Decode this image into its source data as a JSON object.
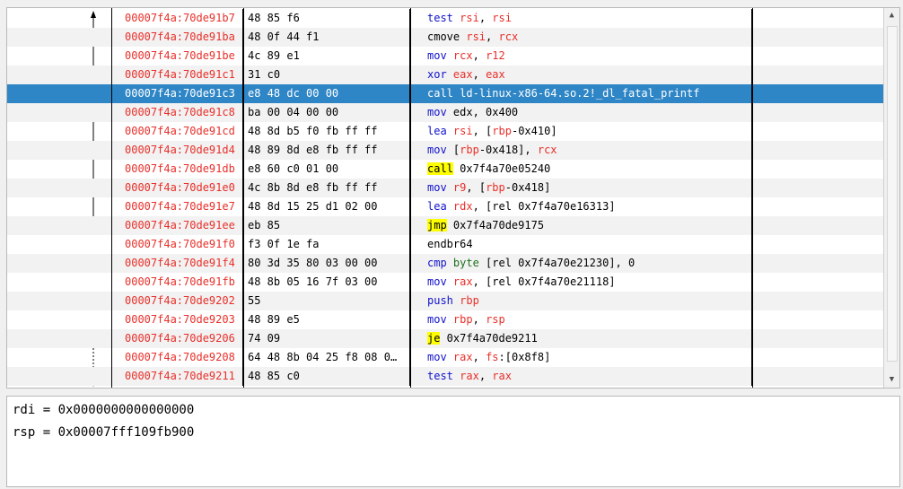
{
  "disassembly": {
    "rows": [
      {
        "addr": "00007f4a:70de91b7",
        "bytes": "48 85 f6",
        "ins": [
          [
            "test",
            "mn-blue"
          ],
          [
            " ",
            ""
          ],
          [
            "rsi",
            "reg"
          ],
          [
            ", ",
            ""
          ],
          [
            "rsi",
            "reg"
          ]
        ]
      },
      {
        "addr": "00007f4a:70de91ba",
        "bytes": "48 0f 44 f1",
        "ins": [
          [
            "cmove",
            "mn-black"
          ],
          [
            " ",
            ""
          ],
          [
            "rsi",
            "reg"
          ],
          [
            ", ",
            ""
          ],
          [
            "rcx",
            "reg"
          ]
        ]
      },
      {
        "addr": "00007f4a:70de91be",
        "bytes": "4c 89 e1",
        "ins": [
          [
            "mov",
            "mn-blue"
          ],
          [
            " ",
            ""
          ],
          [
            "rcx",
            "reg"
          ],
          [
            ", ",
            ""
          ],
          [
            "r12",
            "reg"
          ]
        ]
      },
      {
        "addr": "00007f4a:70de91c1",
        "bytes": "31 c0",
        "ins": [
          [
            "xor",
            "mn-blue"
          ],
          [
            " ",
            ""
          ],
          [
            "eax",
            "reg"
          ],
          [
            ", ",
            ""
          ],
          [
            "eax",
            "reg"
          ]
        ]
      },
      {
        "addr": "00007f4a:70de91c3",
        "bytes": "e8 48 dc 00 00",
        "selected": true,
        "ins": [
          [
            "call ld-linux-x86-64.so.2!_dl_fatal_printf",
            ""
          ]
        ]
      },
      {
        "addr": "00007f4a:70de91c8",
        "bytes": "ba 00 04 00 00",
        "ins": [
          [
            "mov",
            "mn-blue"
          ],
          [
            " edx, 0x400",
            ""
          ]
        ]
      },
      {
        "addr": "00007f4a:70de91cd",
        "bytes": "48 8d b5 f0 fb ff ff",
        "ins": [
          [
            "lea",
            "mn-blue"
          ],
          [
            " ",
            ""
          ],
          [
            "rsi",
            "reg"
          ],
          [
            ", [",
            ""
          ],
          [
            "rbp",
            "reg"
          ],
          [
            "-0x410]",
            ""
          ]
        ]
      },
      {
        "addr": "00007f4a:70de91d4",
        "bytes": "48 89 8d e8 fb ff ff",
        "ins": [
          [
            "mov",
            "mn-blue"
          ],
          [
            " [",
            ""
          ],
          [
            "rbp",
            "reg"
          ],
          [
            "-0x418], ",
            ""
          ],
          [
            "rcx",
            "reg"
          ]
        ]
      },
      {
        "addr": "00007f4a:70de91db",
        "bytes": "e8 60 c0 01 00",
        "ins": [
          [
            "call",
            "hl"
          ],
          [
            " 0x7f4a70e05240",
            ""
          ]
        ]
      },
      {
        "addr": "00007f4a:70de91e0",
        "bytes": "4c 8b 8d e8 fb ff ff",
        "ins": [
          [
            "mov",
            "mn-blue"
          ],
          [
            " ",
            ""
          ],
          [
            "r9",
            "reg"
          ],
          [
            ", [",
            ""
          ],
          [
            "rbp",
            "reg"
          ],
          [
            "-0x418]",
            ""
          ]
        ]
      },
      {
        "addr": "00007f4a:70de91e7",
        "bytes": "48 8d 15 25 d1 02 00",
        "ins": [
          [
            "lea",
            "mn-blue"
          ],
          [
            " ",
            ""
          ],
          [
            "rdx",
            "reg"
          ],
          [
            ", [rel 0x7f4a70e16313]",
            ""
          ]
        ]
      },
      {
        "addr": "00007f4a:70de91ee",
        "bytes": "eb 85",
        "ins": [
          [
            "jmp",
            "hl"
          ],
          [
            " 0x7f4a70de9175",
            ""
          ]
        ]
      },
      {
        "addr": "00007f4a:70de91f0",
        "bytes": "f3 0f 1e fa",
        "ins": [
          [
            "endbr64",
            "mn-black"
          ]
        ]
      },
      {
        "addr": "00007f4a:70de91f4",
        "bytes": "80 3d 35 80 03 00 00",
        "ins": [
          [
            "cmp",
            "mn-blue"
          ],
          [
            " ",
            ""
          ],
          [
            "byte",
            "mn-green"
          ],
          [
            " [rel 0x7f4a70e21230], 0",
            ""
          ]
        ]
      },
      {
        "addr": "00007f4a:70de91fb",
        "bytes": "48 8b 05 16 7f 03 00",
        "ins": [
          [
            "mov",
            "mn-blue"
          ],
          [
            " ",
            ""
          ],
          [
            "rax",
            "reg"
          ],
          [
            ", [rel 0x7f4a70e21118]",
            ""
          ]
        ]
      },
      {
        "addr": "00007f4a:70de9202",
        "bytes": "55",
        "ins": [
          [
            "push",
            "mn-blue"
          ],
          [
            " ",
            ""
          ],
          [
            "rbp",
            "reg"
          ]
        ]
      },
      {
        "addr": "00007f4a:70de9203",
        "bytes": "48 89 e5",
        "ins": [
          [
            "mov",
            "mn-blue"
          ],
          [
            " ",
            ""
          ],
          [
            "rbp",
            "reg"
          ],
          [
            ", ",
            ""
          ],
          [
            "rsp",
            "reg"
          ]
        ]
      },
      {
        "addr": "00007f4a:70de9206",
        "bytes": "74 09",
        "ins": [
          [
            "je",
            "hl"
          ],
          [
            " 0x7f4a70de9211",
            ""
          ]
        ]
      },
      {
        "addr": "00007f4a:70de9208",
        "bytes": "64 48 8b 04 25 f8 08 0…",
        "ins": [
          [
            "mov",
            "mn-blue"
          ],
          [
            " ",
            ""
          ],
          [
            "rax",
            "reg"
          ],
          [
            ", ",
            ""
          ],
          [
            "fs",
            "reg"
          ],
          [
            ":[0x8f8]",
            ""
          ]
        ]
      },
      {
        "addr": "00007f4a:70de9211",
        "bytes": "48 85 c0",
        "ins": [
          [
            "test",
            "mn-blue"
          ],
          [
            " ",
            ""
          ],
          [
            "rax",
            "reg"
          ],
          [
            ", ",
            ""
          ],
          [
            "rax",
            "reg"
          ]
        ]
      }
    ]
  },
  "registers": {
    "lines": [
      "rdi = 0x0000000000000000",
      "rsp = 0x00007fff109fb900"
    ]
  },
  "colors": {
    "address": "#e8302a",
    "register": "#e8302a",
    "mnemonic": "#1111cc",
    "highlight": "#ffff00",
    "selection": "#2f86c6"
  },
  "icons": {
    "scroll_up": "triangle-up-icon",
    "scroll_down": "triangle-down-icon"
  }
}
